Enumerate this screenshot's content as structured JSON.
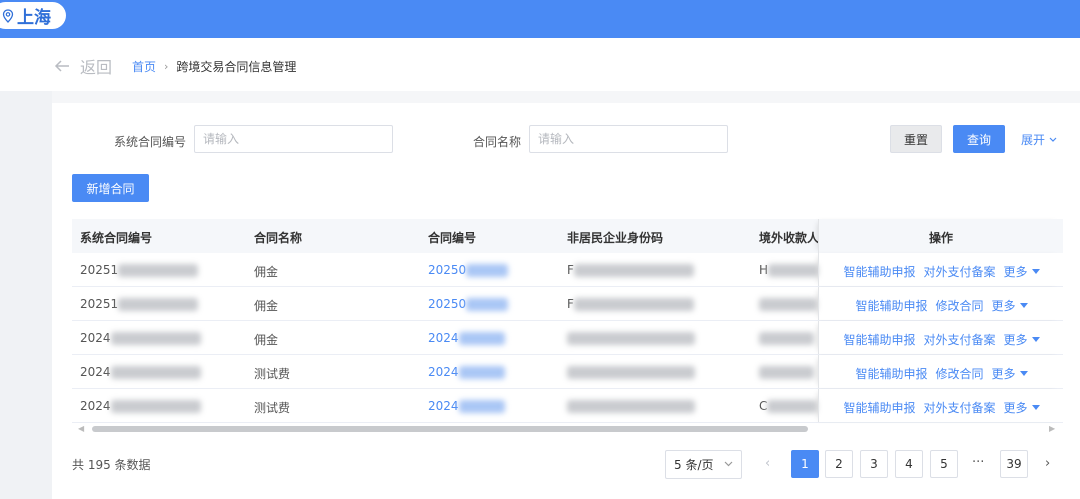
{
  "topbar": {
    "city": "上海"
  },
  "nav": {
    "back_label": "返回",
    "breadcrumb_home": "首页",
    "breadcrumb_current": "跨境交易合同信息管理"
  },
  "filters": {
    "system_no_label": "系统合同编号",
    "system_no_placeholder": "请输入",
    "system_no_value": "",
    "name_label": "合同名称",
    "name_placeholder": "请输入",
    "name_value": ""
  },
  "actions": {
    "reset": "重置",
    "query": "查询",
    "expand": "展开",
    "add": "新增合同"
  },
  "table": {
    "columns": [
      "系统合同编号",
      "合同名称",
      "合同编号",
      "非居民企业身份码",
      "境外收款人",
      "操作"
    ],
    "rows": [
      {
        "system_no": "20251",
        "name": "佣金",
        "contract_no": "20250",
        "id_code": "F",
        "payee": "H",
        "op1": "智能辅助申报",
        "op2": "对外支付备案",
        "more": "更多"
      },
      {
        "system_no": "20251",
        "name": "佣金",
        "contract_no": "20250",
        "id_code": "F",
        "payee": "",
        "op1": "智能辅助申报",
        "op2": "修改合同",
        "more": "更多"
      },
      {
        "system_no": "2024",
        "name": "佣金",
        "contract_no": "2024",
        "id_code": "",
        "payee": "",
        "op1": "智能辅助申报",
        "op2": "对外支付备案",
        "more": "更多"
      },
      {
        "system_no": "2024",
        "name": "测试费",
        "contract_no": "2024",
        "id_code": "",
        "payee": "",
        "op1": "智能辅助申报",
        "op2": "修改合同",
        "more": "更多"
      },
      {
        "system_no": "2024",
        "name": "测试费",
        "contract_no": "2024",
        "id_code": "",
        "payee": "C",
        "op1": "智能辅助申报",
        "op2": "对外支付备案",
        "more": "更多"
      }
    ]
  },
  "pagination": {
    "total_text": "共 195 条数据",
    "page_size": "5 条/页",
    "pages": [
      "1",
      "2",
      "3",
      "4",
      "5"
    ],
    "ellipsis": "···",
    "last_page": "39",
    "current": "1"
  },
  "colors": {
    "brand": "#4a8af4",
    "header_bg": "#f5f7fa"
  }
}
